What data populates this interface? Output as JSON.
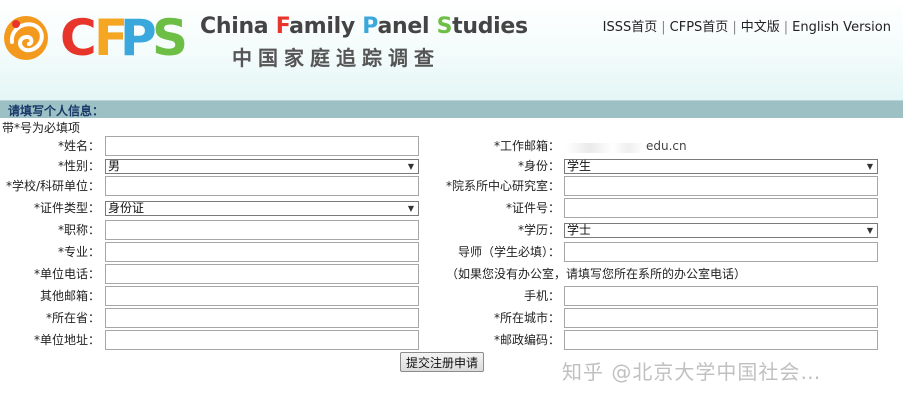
{
  "header": {
    "logo_letters": [
      "C",
      "F",
      "P",
      "S"
    ],
    "title_en_parts": [
      "China ",
      "F",
      "amily ",
      "P",
      "anel ",
      "S",
      "tudies"
    ],
    "title_cn": "中国家庭追踪调查",
    "nav": [
      "ISSS首页",
      "CFPS首页",
      "中文版",
      "English Version"
    ],
    "nav_separator": "|",
    "colors": {
      "c": "#e8352b",
      "f": "#f5a623",
      "p": "#3aa8dc",
      "s": "#6dbe45"
    }
  },
  "section_title": "请填写个人信息：",
  "required_note": "带*号为必填项",
  "form": {
    "name": {
      "label": "*姓名：",
      "value": ""
    },
    "gender": {
      "label": "*性别：",
      "value": "男"
    },
    "school": {
      "label": "*学校/科研单位：",
      "value": ""
    },
    "id_type": {
      "label": "*证件类型：",
      "value": "身份证"
    },
    "title": {
      "label": "*职称：",
      "value": ""
    },
    "major": {
      "label": "*专业：",
      "value": ""
    },
    "work_phone": {
      "label": "*单位电话：",
      "value": ""
    },
    "other_email": {
      "label": "其他邮箱：",
      "value": ""
    },
    "province": {
      "label": "*所在省：",
      "value": ""
    },
    "work_address": {
      "label": "*单位地址：",
      "value": ""
    },
    "work_email": {
      "label": "*工作邮箱：",
      "value": "edu.cn"
    },
    "identity": {
      "label": "*身份：",
      "value": "学生"
    },
    "department": {
      "label": "*院系所中心研究室：",
      "value": ""
    },
    "id_number": {
      "label": "*证件号：",
      "value": ""
    },
    "education": {
      "label": "*学历：",
      "value": "学士"
    },
    "advisor": {
      "label": "导师（学生必填）：",
      "value": ""
    },
    "office_hint": "（如果您没有办公室，请填写您所在系所的办公室电话）",
    "mobile": {
      "label": "手机：",
      "value": ""
    },
    "city": {
      "label": "*所在城市：",
      "value": ""
    },
    "postcode": {
      "label": "*邮政编码：",
      "value": ""
    }
  },
  "submit_label": "提交注册申请",
  "watermark": "知乎 @北京大学中国社会…"
}
